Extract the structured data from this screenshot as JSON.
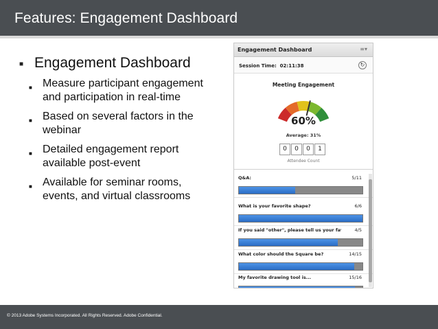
{
  "slide": {
    "title": "Features: Engagement Dashboard",
    "footer": "© 2013 Adobe Systems Incorporated.  All Rights Reserved.  Adobe Confidential."
  },
  "bullets": {
    "heading": "Engagement Dashboard",
    "items": [
      {
        "line1": "Measure participant engagement",
        "line2": "and participation in real-time"
      },
      {
        "line1": "Based on several factors in the",
        "line2": "webinar"
      },
      {
        "line1": "Detailed engagement report",
        "line2": "available post-event"
      },
      {
        "line1": "Available for seminar rooms,",
        "line2": "events, and virtual classrooms"
      }
    ]
  },
  "panel": {
    "title": "Engagement Dashboard",
    "menu_icon": "menu-icon",
    "session_label": "Session Time:",
    "session_time": "02:11:38",
    "meeting_title": "Meeting Engagement",
    "engagement_pct": "60%",
    "engagement_value": 60,
    "average_label": "Average: 31%",
    "attendee_digits": [
      "0",
      "0",
      "0",
      "1"
    ],
    "attendee_label": "Attendee Count",
    "gauge_colors": [
      "#cc2a2a",
      "#e46a2a",
      "#e0c21c",
      "#7cb82f",
      "#2f8f3a"
    ]
  },
  "questions": [
    {
      "label": "Q&A:",
      "count": "5/11",
      "fraction": 0.455
    },
    {
      "label": "What is your favorite shape?",
      "count": "6/6",
      "fraction": 1.0
    },
    {
      "label": "If you said \"other\", please tell us your favour...",
      "count": "4/5",
      "fraction": 0.8
    },
    {
      "label": "What color should the Square be?",
      "count": "14/15",
      "fraction": 0.933
    },
    {
      "label": "My favorite drawing tool is...",
      "count": "15/16",
      "fraction": 0.9375
    }
  ]
}
